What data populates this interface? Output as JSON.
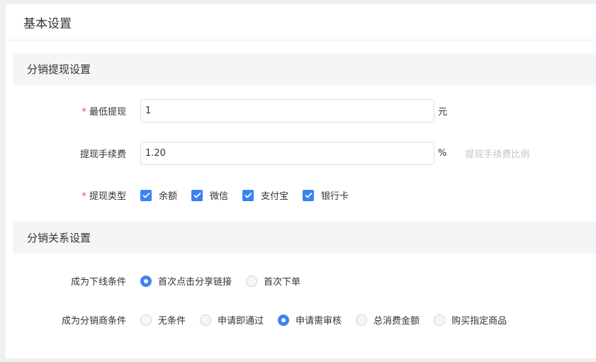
{
  "card": {
    "title": "基本设置"
  },
  "sections": {
    "withdraw": {
      "title": "分销提现设置"
    },
    "relation": {
      "title": "分销关系设置"
    }
  },
  "min_withdraw": {
    "required_mark": "*",
    "label": "最低提现",
    "value": "1",
    "unit": "元"
  },
  "fee": {
    "label": "提现手续费",
    "value": "1.20",
    "unit": "%",
    "hint": "提现手续费比例"
  },
  "withdraw_type": {
    "required_mark": "*",
    "label": "提现类型",
    "options": [
      {
        "label": "余额",
        "checked": true
      },
      {
        "label": "微信",
        "checked": true
      },
      {
        "label": "支付宝",
        "checked": true
      },
      {
        "label": "银行卡",
        "checked": true
      }
    ]
  },
  "downline_condition": {
    "label": "成为下线条件",
    "options": [
      {
        "label": "首次点击分享链接",
        "selected": true
      },
      {
        "label": "首次下单",
        "selected": false
      }
    ]
  },
  "distributor_condition": {
    "label": "成为分销商条件",
    "options": [
      {
        "label": "无条件",
        "selected": false
      },
      {
        "label": "申请即通过",
        "selected": false
      },
      {
        "label": "申请需审核",
        "selected": true
      },
      {
        "label": "总消费金额",
        "selected": false
      },
      {
        "label": "购买指定商品",
        "selected": false
      }
    ]
  },
  "colors": {
    "accent": "#3b82f6",
    "required": "#e84a3c",
    "hint": "#c0c4cc",
    "section_bg": "#f4f5f7"
  }
}
